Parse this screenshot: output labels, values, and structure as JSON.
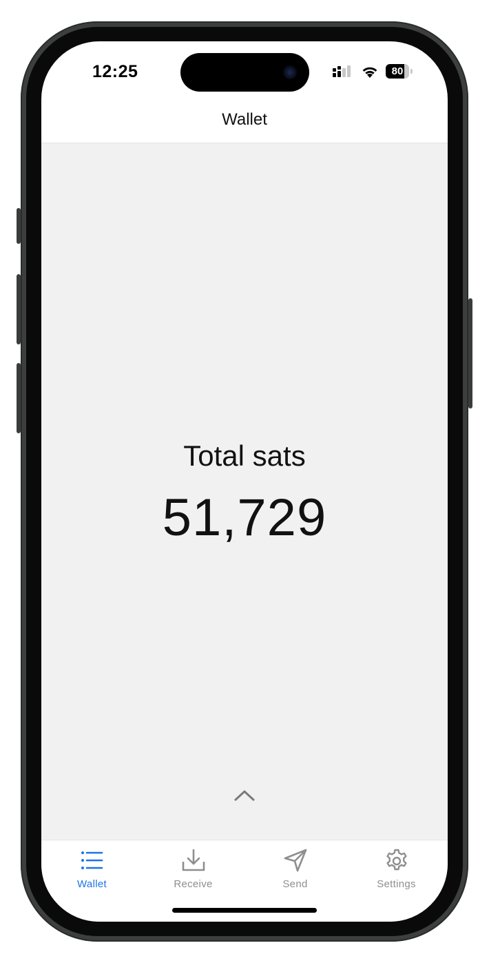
{
  "status_bar": {
    "time": "12:25",
    "battery_level": "80"
  },
  "nav": {
    "title": "Wallet"
  },
  "balance": {
    "label": "Total sats",
    "value": "51,729"
  },
  "tabs": [
    {
      "label": "Wallet",
      "icon": "list-icon",
      "active": true
    },
    {
      "label": "Receive",
      "icon": "download-icon",
      "active": false
    },
    {
      "label": "Send",
      "icon": "send-icon",
      "active": false
    },
    {
      "label": "Settings",
      "icon": "gear-icon",
      "active": false
    }
  ],
  "colors": {
    "accent": "#1a73e8",
    "inactive": "#8e8e8e",
    "content_bg": "#f1f1f1"
  }
}
